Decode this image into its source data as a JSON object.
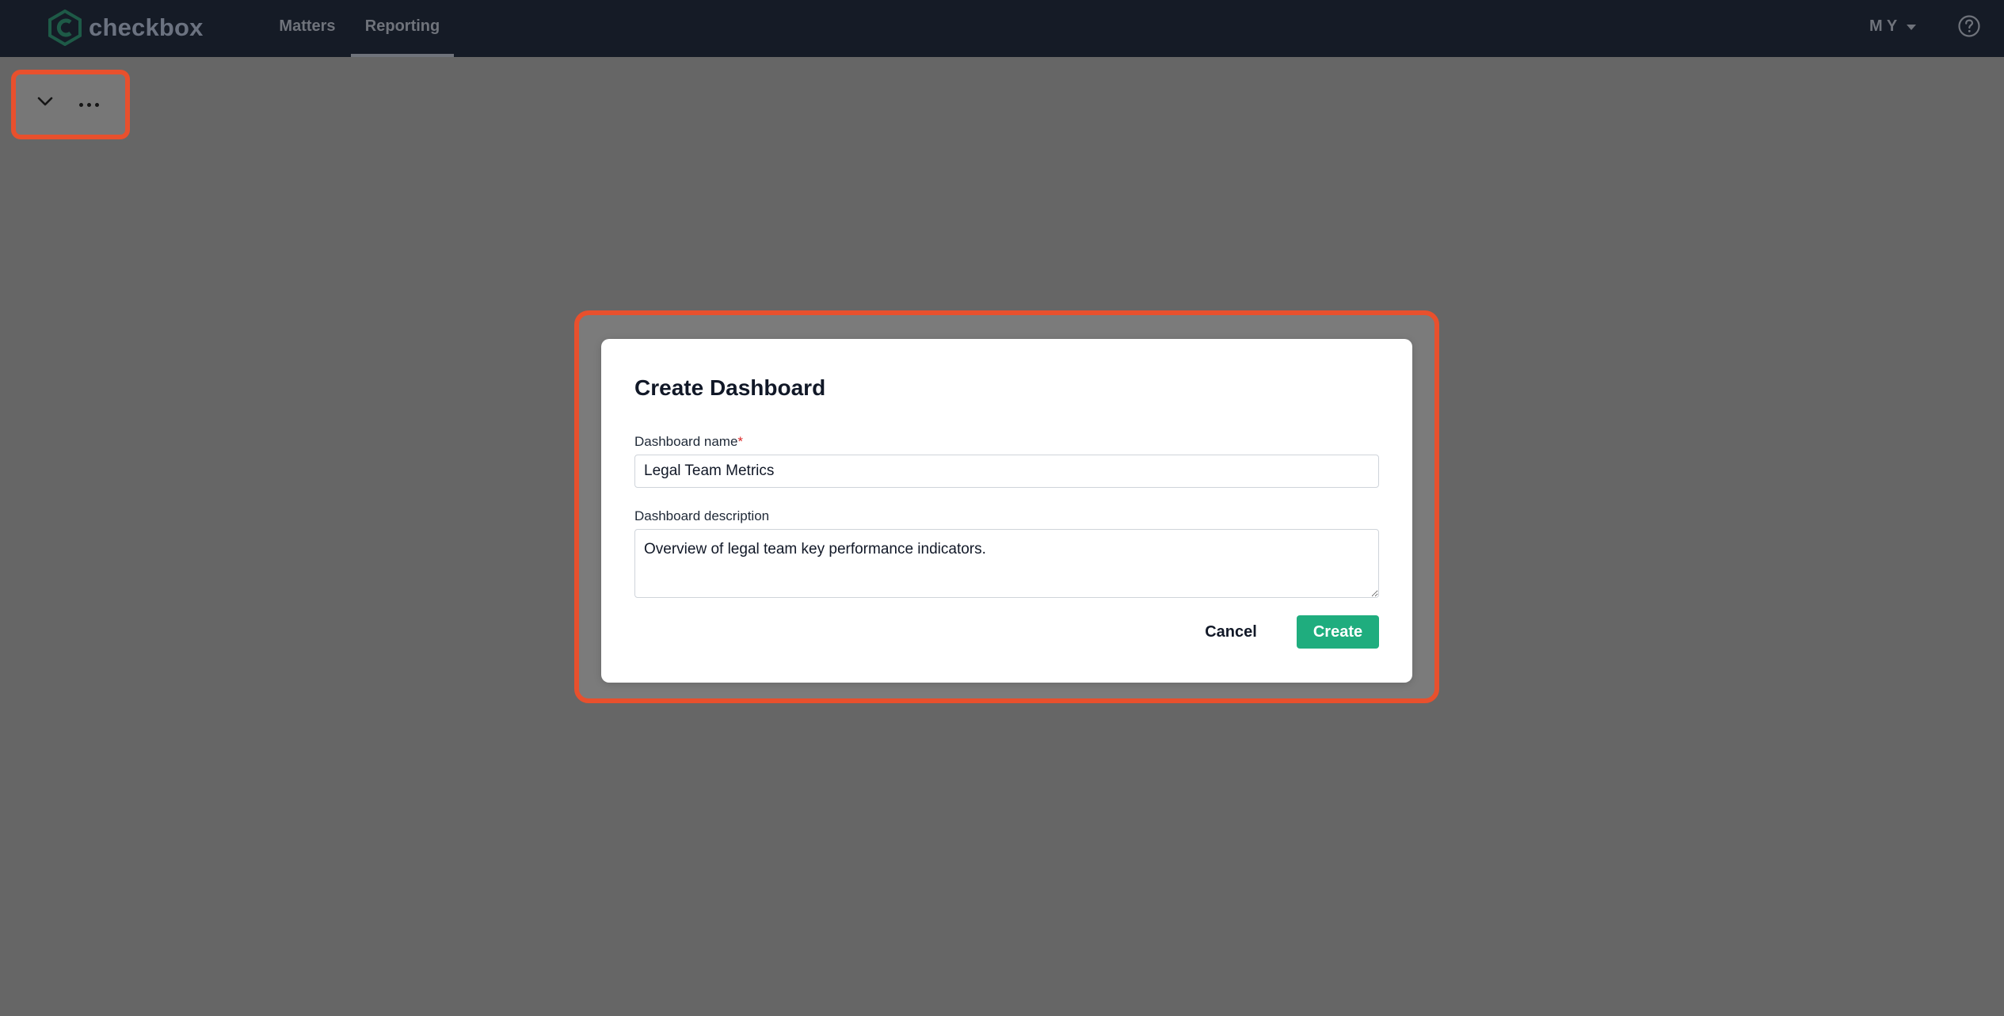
{
  "app": {
    "logo_text": "checkbox",
    "brand_color": "#1fad7e"
  },
  "nav": {
    "tabs": [
      {
        "label": "Matters",
        "active": false
      },
      {
        "label": "Reporting",
        "active": true
      }
    ]
  },
  "user_menu": {
    "initials": "M Y",
    "icon": "chevron-down-icon"
  },
  "help": {
    "icon": "help-circle-icon"
  },
  "toolbar": {
    "collapse_icon": "chevron-down-icon",
    "more_icon": "more-horizontal-icon"
  },
  "modal": {
    "title": "Create Dashboard",
    "name_label": "Dashboard name",
    "required_marker": "*",
    "name_value": "Legal Team Metrics",
    "description_label": "Dashboard description",
    "description_value": "Overview of legal team key performance indicators.",
    "cancel_label": "Cancel",
    "create_label": "Create"
  },
  "colors": {
    "topbar": "#151b26",
    "overlay": "#666666",
    "highlight": "#e8502d",
    "primary_button": "#1fad7e"
  }
}
